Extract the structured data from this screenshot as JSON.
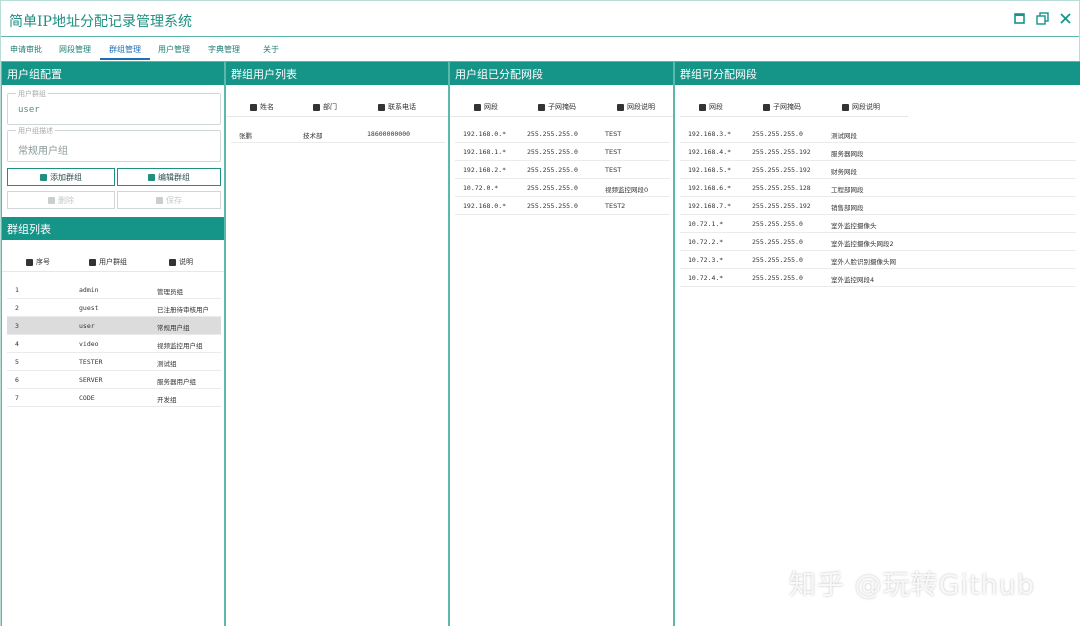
{
  "app": {
    "title": "简单IP地址分配记录管理系统"
  },
  "window_controls": [
    "maximize-icon",
    "restore-icon",
    "close-icon"
  ],
  "menu": {
    "tabs": [
      {
        "label": "申请审批"
      },
      {
        "label": "网段管理"
      },
      {
        "label": "群组管理",
        "active": true
      },
      {
        "label": "用户管理"
      },
      {
        "label": "字典管理"
      },
      {
        "label": "关于"
      }
    ]
  },
  "group_config": {
    "header": "用户组配置",
    "group_field": {
      "legend": "用户群组",
      "value": "user"
    },
    "desc_field": {
      "legend": "用户组描述",
      "value": "常规用户组"
    },
    "buttons": {
      "add": "添加群组",
      "edit": "编辑群组",
      "delete": "删除",
      "save": "保存"
    }
  },
  "group_list": {
    "header": "群组列表",
    "columns": [
      "序号",
      "用户群组",
      "说明"
    ],
    "rows": [
      [
        "1",
        "admin",
        "管理员组"
      ],
      [
        "2",
        "guest",
        "已注册待审核用户"
      ],
      [
        "3",
        "user",
        "常规用户组"
      ],
      [
        "4",
        "video",
        "视频监控用户组"
      ],
      [
        "5",
        "TESTER",
        "测试组"
      ],
      [
        "6",
        "SERVER",
        "服务器用户组"
      ],
      [
        "7",
        "CODE",
        "开发组"
      ]
    ],
    "selected_index": 2
  },
  "group_users": {
    "header": "群组用户列表",
    "columns": [
      "姓名",
      "部门",
      "联系电话"
    ],
    "rows": [
      [
        "张鹏",
        "技术部",
        "18600000000"
      ]
    ]
  },
  "assigned_segments": {
    "header": "用户组已分配网段",
    "columns": [
      "网段",
      "子网掩码",
      "网段说明"
    ],
    "rows": [
      [
        "192.168.0.*",
        "255.255.255.0",
        "TEST"
      ],
      [
        "192.168.1.*",
        "255.255.255.0",
        "TEST"
      ],
      [
        "192.168.2.*",
        "255.255.255.0",
        "TEST"
      ],
      [
        "10.72.0.*",
        "255.255.255.0",
        "视频监控网段0"
      ],
      [
        "192.168.0.*",
        "255.255.255.0",
        "TEST2"
      ]
    ]
  },
  "available_segments": {
    "header": "群组可分配网段",
    "columns": [
      "网段",
      "子网掩码",
      "网段说明"
    ],
    "rows": [
      [
        "192.168.3.*",
        "255.255.255.0",
        "测试网段"
      ],
      [
        "192.168.4.*",
        "255.255.255.192",
        "服务器网段"
      ],
      [
        "192.168.5.*",
        "255.255.255.192",
        "财务网段"
      ],
      [
        "192.168.6.*",
        "255.255.255.128",
        "工程部网段"
      ],
      [
        "192.168.7.*",
        "255.255.255.192",
        "销售部网段"
      ],
      [
        "10.72.1.*",
        "255.255.255.0",
        "室外监控摄像头"
      ],
      [
        "10.72.2.*",
        "255.255.255.0",
        "室外监控摄像头网段2"
      ],
      [
        "10.72.3.*",
        "255.255.255.0",
        "室外人脸识别摄像头网"
      ],
      [
        "10.72.4.*",
        "255.255.255.0",
        "室外监控网段4"
      ]
    ]
  },
  "watermark": "知乎 @玩转Github",
  "colors": {
    "accent": "#159488",
    "title": "#1f8f80",
    "active_tab": "#1e6fb8",
    "selected_row": "#dcdcdc"
  }
}
